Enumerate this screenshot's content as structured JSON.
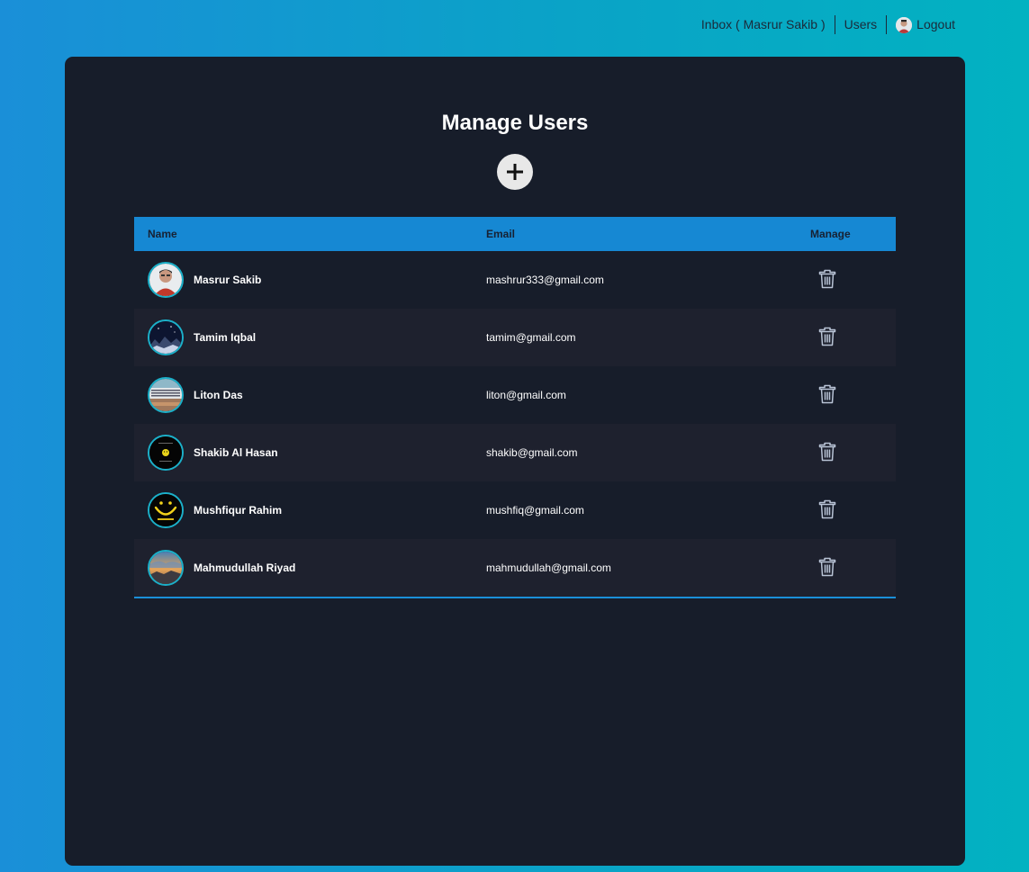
{
  "nav": {
    "inbox": "Inbox ( Masrur Sakib )",
    "users": "Users",
    "logout": "Logout"
  },
  "page": {
    "title": "Manage Users",
    "add_icon": "plus-icon"
  },
  "table": {
    "headers": {
      "name": "Name",
      "email": "Email",
      "manage": "Manage"
    },
    "rows": [
      {
        "name": "Masrur Sakib",
        "email": "mashrur333@gmail.com",
        "avatar": "person-photo"
      },
      {
        "name": "Tamim Iqbal",
        "email": "tamim@gmail.com",
        "avatar": "night-sky-photo"
      },
      {
        "name": "Liton Das",
        "email": "liton@gmail.com",
        "avatar": "building-photo"
      },
      {
        "name": "Shakib Al Hasan",
        "email": "shakib@gmail.com",
        "avatar": "smiley-dark-photo"
      },
      {
        "name": "Mushfiqur Rahim",
        "email": "mushfiq@gmail.com",
        "avatar": "be-happy-smiley-photo"
      },
      {
        "name": "Mahmudullah Riyad",
        "email": "mahmudullah@gmail.com",
        "avatar": "sunset-photo"
      }
    ]
  },
  "colors": {
    "panel_bg": "#171d2a",
    "header_bg": "#1688d3",
    "accent": "#1bb0c9"
  }
}
